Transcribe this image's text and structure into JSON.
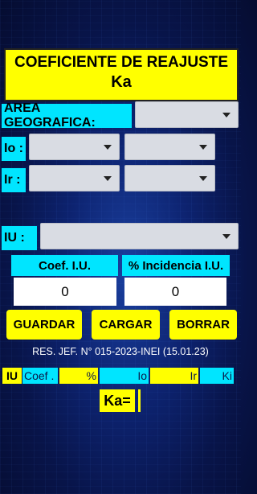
{
  "title": {
    "line1": "COEFICIENTE DE REAJUSTE",
    "line2": "Ka"
  },
  "area": {
    "label": "AREA GEOGRAFICA:",
    "value": ""
  },
  "io": {
    "label": "Io :",
    "select1": "",
    "select2": ""
  },
  "ir": {
    "label": "Ir :",
    "select1": "",
    "select2": ""
  },
  "iu": {
    "label": "IU :",
    "value": ""
  },
  "coef": {
    "label": "Coef. I.U.",
    "value": "0"
  },
  "incidencia": {
    "label": "% Incidencia I.U.",
    "value": "0"
  },
  "buttons": {
    "guardar": "GUARDAR",
    "cargar": "CARGAR",
    "borrar": "BORRAR"
  },
  "resolution": "RES. JEF. N° 015-2023-INEI (15.01.23)",
  "results": {
    "iu": "IU",
    "coef": "Coef .",
    "pct": "%",
    "io": "Io",
    "ir": "Ir",
    "ki": "Ki"
  },
  "ka": {
    "label": "Ka=",
    "value": ""
  },
  "colors": {
    "yellow": "#ffff00",
    "cyan": "#00e5ff",
    "background": "#0d2370"
  }
}
